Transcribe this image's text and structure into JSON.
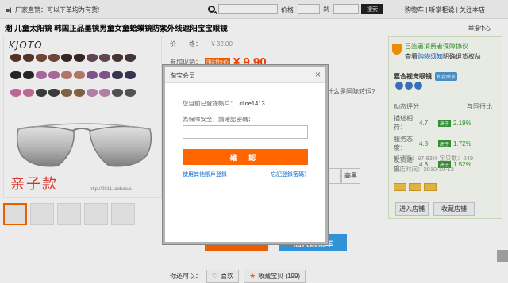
{
  "topbar": {
    "notice": "厂家直销：可以下单均为有货!",
    "keyword_placeholder": "",
    "price_label": "价格",
    "price_to": "到",
    "search_button": "搜索",
    "links": "购物车 | 听掌柜说 | 关注本店"
  },
  "product": {
    "title": "潮 儿童太阳镜 韩国正品墨镜男童女童蛤蟆镜防紫外线遮阳宝宝眼镜",
    "report": "举报中心",
    "logo": "KJOTO",
    "kids_text": "亲子款",
    "watermark": "http://2911.taobao.c"
  },
  "price": {
    "label": "价　　格：",
    "original": "¥ 32.00",
    "promo_label": "参加促销：",
    "promo_badge": "限时特价",
    "promo_price": "¥ 9.90",
    "bg_text": "什么是国际转运?",
    "qty_label": "高黑"
  },
  "actions": {
    "buy": "",
    "cart": "加入购物车"
  },
  "bottom": {
    "share_label": "你还可以：",
    "like": "喜欢",
    "favorite": "收藏宝贝 (199)"
  },
  "seller": {
    "guarantee": "已签署消费者保障协议",
    "guarantee_line2_prefix": "查看",
    "guarantee_link": "购物须知",
    "guarantee_line2_suffix": "明确退货权益",
    "name": "嘉合视觉眼镜",
    "contact": "和我联系",
    "dynamic_title": "动态评分",
    "compare_title": "与同行比",
    "ratings": [
      {
        "label": "描述相符：",
        "score": "4.7",
        "cmp": "高于",
        "pct": "2.19%"
      },
      {
        "label": "服务态度：",
        "score": "4.8",
        "cmp": "高于",
        "pct": "1.72%"
      },
      {
        "label": "发货速度：",
        "score": "4.8",
        "cmp": "高于",
        "pct": "1.52%"
      }
    ],
    "good_rate": "好评率：97.83%  宝贝数：249",
    "created": "创店时间：2010-10-13",
    "enter_shop": "进入店铺",
    "fav_shop": "收藏店铺"
  },
  "dialog": {
    "title": "淘宝会员",
    "close": "×",
    "user_label": "您目前已登錄帳戶：",
    "username": "cline1413",
    "hint": "為保障安全，請確認密碼：",
    "confirm": "確 認",
    "other_account": "使用其他賬戶登錄",
    "forgot": "忘記登錄密碼？"
  }
}
